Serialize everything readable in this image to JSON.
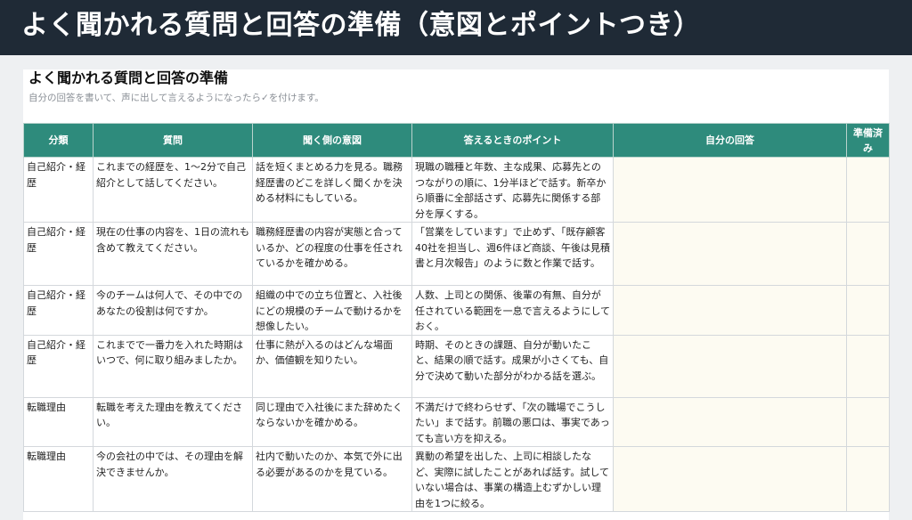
{
  "banner": {
    "title": "よく聞かれる質問と回答の準備（意図とポイントつき）"
  },
  "doc": {
    "title": "よく聞かれる質問と回答の準備",
    "subtitle": "自分の回答を書いて、声に出して言えるようになったら✓を付けます。"
  },
  "table": {
    "headers": [
      "分類",
      "質問",
      "聞く側の意図",
      "答えるときのポイント",
      "自分の回答",
      "準備済み"
    ],
    "rows": [
      {
        "category": "自己紹介・経歴",
        "question": "これまでの経歴を、1〜2分で自己紹介として話してください。",
        "intent": "話を短くまとめる力を見る。職務経歴書のどこを詳しく聞くかを決める材料にもしている。",
        "point": "現職の職種と年数、主な成果、応募先とのつながりの順に、1分半ほどで話す。新卒から順番に全部話さず、応募先に関係する部分を厚くする。",
        "answer": "",
        "ready": ""
      },
      {
        "category": "自己紹介・経歴",
        "question": "現在の仕事の内容を、1日の流れも含めて教えてください。",
        "intent": "職務経歴書の内容が実態と合っているか、どの程度の仕事を任されているかを確かめる。",
        "point": "「営業をしています」で止めず、「既存顧客40社を担当し、週6件ほど商談、午後は見積書と月次報告」のように数と作業で話す。",
        "answer": "",
        "ready": ""
      },
      {
        "category": "自己紹介・経歴",
        "question": "今のチームは何人で、その中でのあなたの役割は何ですか。",
        "intent": "組織の中での立ち位置と、入社後にどの規模のチームで動けるかを想像したい。",
        "point": "人数、上司との関係、後輩の有無、自分が任されている範囲を一息で言えるようにしておく。",
        "answer": "",
        "ready": ""
      },
      {
        "category": "自己紹介・経歴",
        "question": "これまでで一番力を入れた時期はいつで、何に取り組みましたか。",
        "intent": "仕事に熱が入るのはどんな場面か、価値観を知りたい。",
        "point": "時期、そのときの課題、自分が動いたこと、結果の順で話す。成果が小さくても、自分で決めて動いた部分がわかる話を選ぶ。",
        "answer": "",
        "ready": ""
      },
      {
        "category": "転職理由",
        "question": "転職を考えた理由を教えてください。",
        "intent": "同じ理由で入社後にまた辞めたくならないかを確かめる。",
        "point": "不満だけで終わらせず、「次の職場でこうしたい」まで話す。前職の悪口は、事実であっても言い方を抑える。",
        "answer": "",
        "ready": ""
      },
      {
        "category": "転職理由",
        "question": "今の会社の中では、その理由を解決できませんか。",
        "intent": "社内で動いたのか、本気で外に出る必要があるのかを見ている。",
        "point": "異動の希望を出した、上司に相談したなど、実際に試したことがあれば話す。試していない場合は、事業の構造上むずかしい理由を1つに絞る。",
        "answer": "",
        "ready": ""
      }
    ]
  }
}
